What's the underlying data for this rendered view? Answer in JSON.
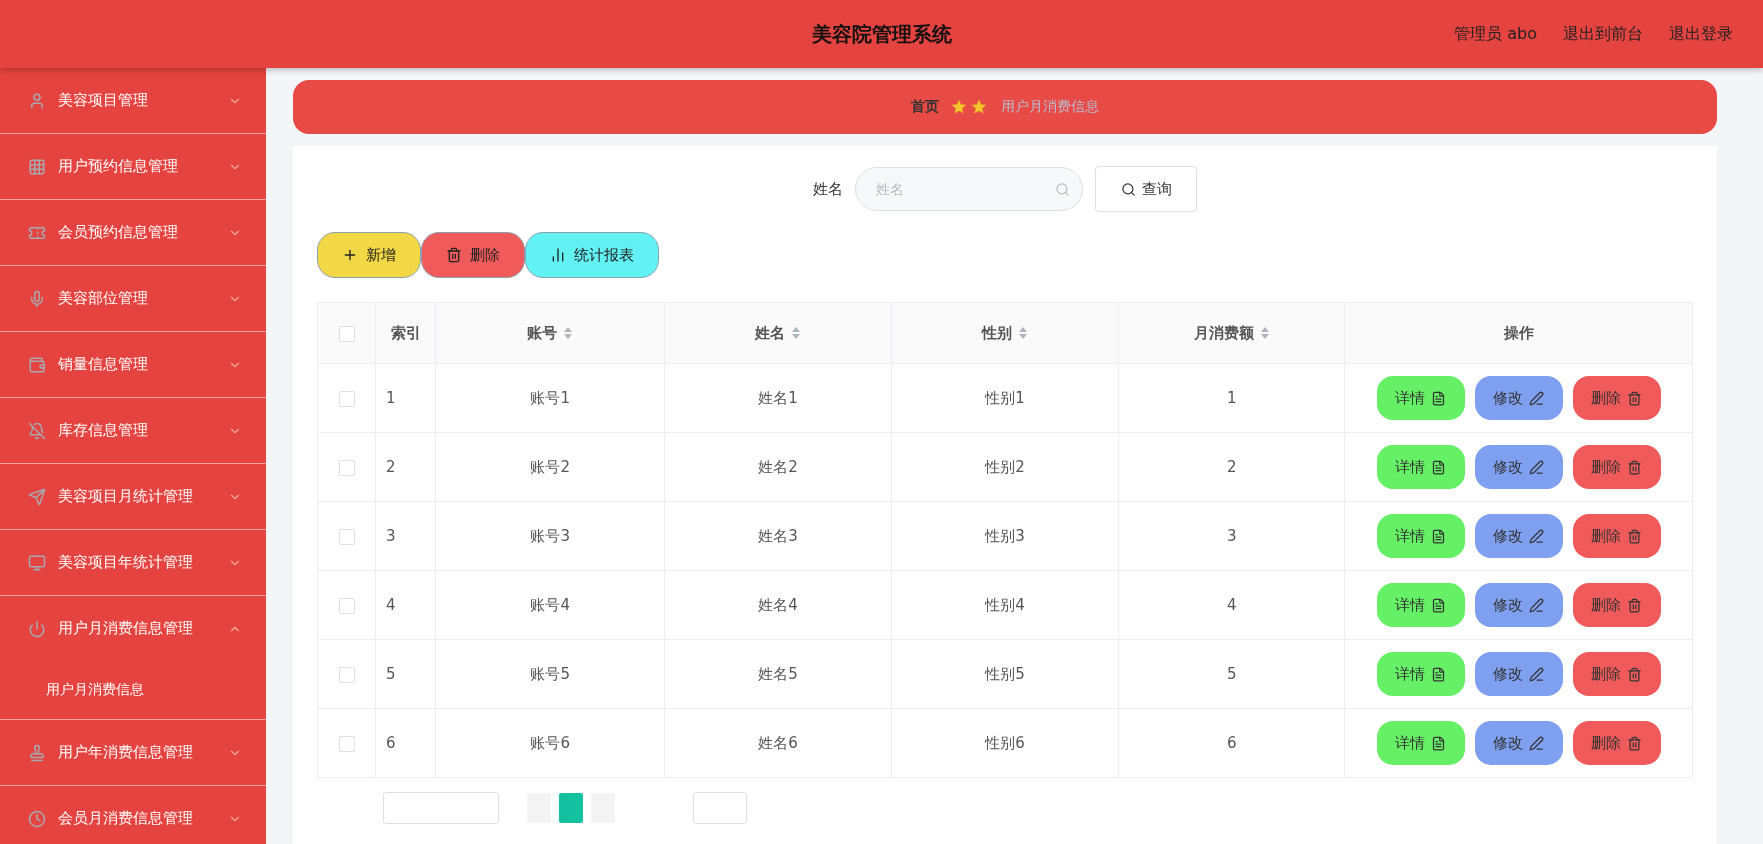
{
  "header": {
    "title": "美容院管理系统",
    "links": [
      "管理员 abo",
      "退出到前台",
      "退出登录"
    ]
  },
  "sidebar": {
    "items": [
      {
        "label": "美容项目管理",
        "expanded": false
      },
      {
        "label": "用户预约信息管理",
        "expanded": false
      },
      {
        "label": "会员预约信息管理",
        "expanded": false
      },
      {
        "label": "美容部位管理",
        "expanded": false
      },
      {
        "label": "销量信息管理",
        "expanded": false
      },
      {
        "label": "库存信息管理",
        "expanded": false
      },
      {
        "label": "美容项目月统计管理",
        "expanded": false
      },
      {
        "label": "美容项目年统计管理",
        "expanded": false
      },
      {
        "label": "用户月消费信息管理",
        "expanded": true,
        "children": [
          {
            "label": "用户月消费信息"
          }
        ]
      },
      {
        "label": "用户年消费信息管理",
        "expanded": false
      },
      {
        "label": "会员月消费信息管理",
        "expanded": false
      }
    ]
  },
  "breadcrumb": {
    "home": "首页",
    "current": "用户月消费信息"
  },
  "search": {
    "label": "姓名",
    "placeholder": "姓名",
    "button": "查询"
  },
  "toolbar": [
    {
      "label": "新增",
      "kind": "add"
    },
    {
      "label": "删除",
      "kind": "delete"
    },
    {
      "label": "统计报表",
      "kind": "report"
    }
  ],
  "table": {
    "select_all_checked": false,
    "columns": [
      {
        "label": "索引",
        "sortable": false
      },
      {
        "label": "账号",
        "sortable": true
      },
      {
        "label": "姓名",
        "sortable": true
      },
      {
        "label": "性别",
        "sortable": true
      },
      {
        "label": "月消费额",
        "sortable": true
      },
      {
        "label": "操作",
        "sortable": false
      }
    ],
    "rows": [
      {
        "checked": false,
        "cells": [
          "1",
          "账号1",
          "姓名1",
          "性别1",
          "1"
        ],
        "actions": [
          {
            "label": "详情",
            "kind": "detail"
          },
          {
            "label": "修改",
            "kind": "edit"
          },
          {
            "label": "删除",
            "kind": "delete"
          }
        ]
      },
      {
        "checked": false,
        "cells": [
          "2",
          "账号2",
          "姓名2",
          "性别2",
          "2"
        ],
        "actions": [
          {
            "label": "详情",
            "kind": "detail"
          },
          {
            "label": "修改",
            "kind": "edit"
          },
          {
            "label": "删除",
            "kind": "delete"
          }
        ]
      },
      {
        "checked": false,
        "cells": [
          "3",
          "账号3",
          "姓名3",
          "性别3",
          "3"
        ],
        "actions": [
          {
            "label": "详情",
            "kind": "detail"
          },
          {
            "label": "修改",
            "kind": "edit"
          },
          {
            "label": "删除",
            "kind": "delete"
          }
        ]
      },
      {
        "checked": false,
        "cells": [
          "4",
          "账号4",
          "姓名4",
          "性别4",
          "4"
        ],
        "actions": [
          {
            "label": "详情",
            "kind": "detail"
          },
          {
            "label": "修改",
            "kind": "edit"
          },
          {
            "label": "删除",
            "kind": "delete"
          }
        ]
      },
      {
        "checked": false,
        "cells": [
          "5",
          "账号5",
          "姓名5",
          "性别5",
          "5"
        ],
        "actions": [
          {
            "label": "详情",
            "kind": "detail"
          },
          {
            "label": "修改",
            "kind": "edit"
          },
          {
            "label": "删除",
            "kind": "delete"
          }
        ]
      },
      {
        "checked": false,
        "cells": [
          "6",
          "账号6",
          "姓名6",
          "性别6",
          "6"
        ],
        "actions": [
          {
            "label": "详情",
            "kind": "detail"
          },
          {
            "label": "修改",
            "kind": "edit"
          },
          {
            "label": "删除",
            "kind": "delete"
          }
        ]
      }
    ]
  },
  "pagination": {
    "pages": [
      {
        "selected": false
      },
      {
        "selected": true
      },
      {
        "selected": false
      }
    ]
  }
}
